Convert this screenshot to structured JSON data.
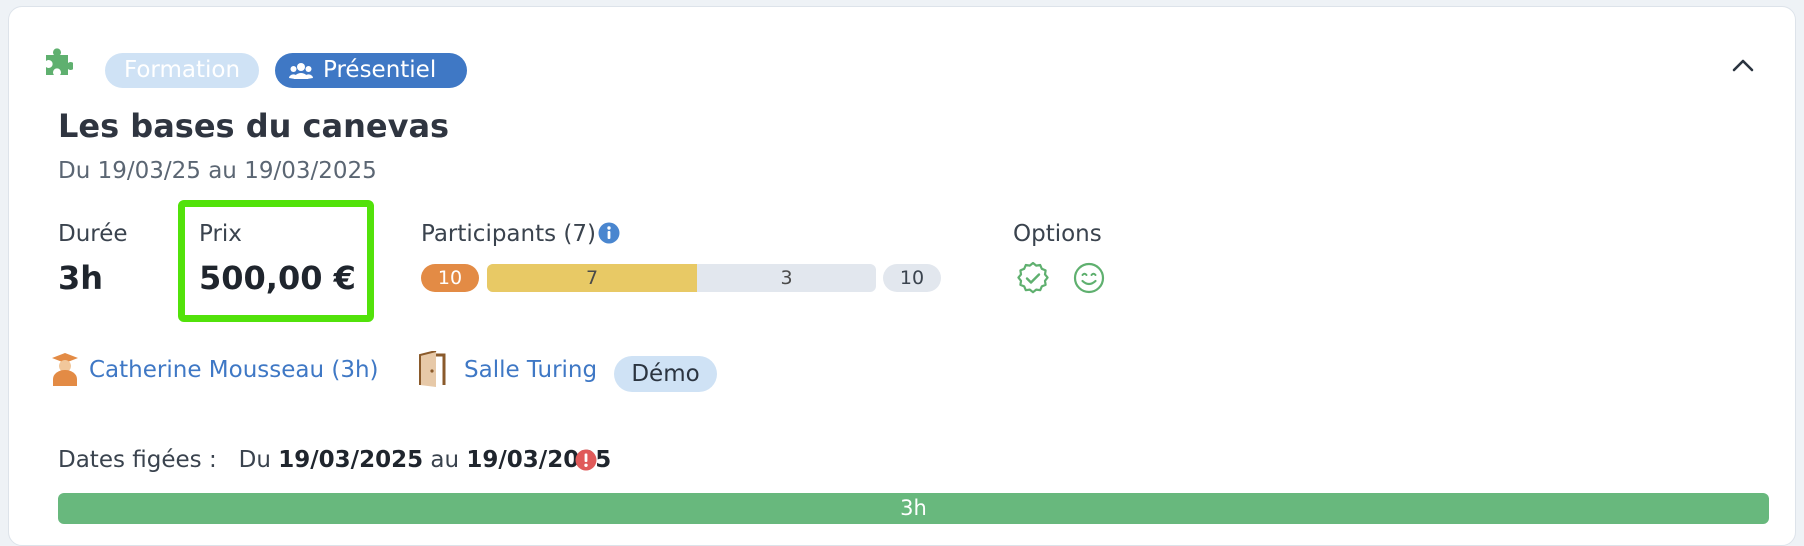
{
  "tags": {
    "formation": "Formation",
    "presentiel": "Présentiel"
  },
  "course": {
    "title": "Les bases du canevas",
    "dates": "Du 19/03/25 au 19/03/2025"
  },
  "duration": {
    "label": "Durée",
    "value": "3h"
  },
  "price": {
    "label": "Prix",
    "value": "500,00 €"
  },
  "participants": {
    "label": "Participants (7)",
    "min_badge": "10",
    "filled": "7",
    "remaining": "3",
    "max_badge": "10",
    "fill_fraction": 0.7
  },
  "options": {
    "label": "Options"
  },
  "trainer": {
    "name": "Catherine Mousseau (3h)"
  },
  "room": {
    "name": "Salle Turing",
    "badge": "Démo"
  },
  "frozen": {
    "label": "Dates figées :",
    "du": "Du",
    "start": "19/03/2025",
    "au": "au",
    "end": "19/03/2025"
  },
  "timeline": {
    "value": "3h"
  },
  "colors": {
    "accent": "#3f78c5",
    "green": "#68b87d",
    "highlight": "#52e20a",
    "orange": "#e38b45",
    "yellow": "#e8c965"
  }
}
